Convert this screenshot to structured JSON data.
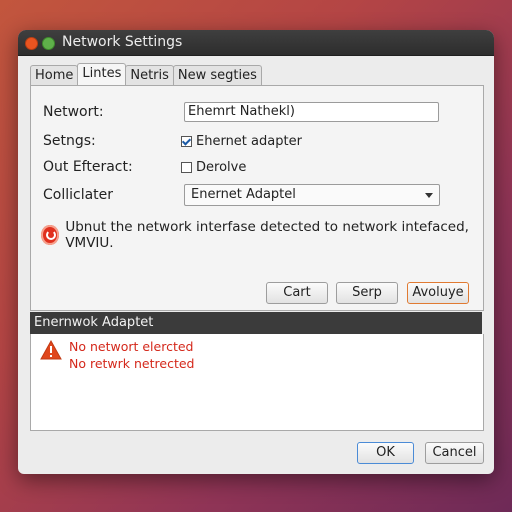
{
  "window": {
    "title": "Network Settings"
  },
  "tabs": [
    {
      "label": "Home",
      "active": false
    },
    {
      "label": "Lintes",
      "active": true
    },
    {
      "label": "Netris",
      "active": false
    },
    {
      "label": "New segties",
      "active": false
    }
  ],
  "form": {
    "network_label": "Networt:",
    "network_value": "Ehemrt Nathekl)",
    "settings_label": "Setngs:",
    "settings_checkbox_label": "Ehernet adapter",
    "settings_checked": true,
    "out_label": "Out Efteract:",
    "out_checkbox_label": "Derolve",
    "out_checked": false,
    "collector_label": "Colliclater",
    "collector_value": "Enernet Adaptel"
  },
  "info_message": "Ubnut the network interfase detected to network intefaced, VMVIU.",
  "buttons": {
    "cart": "Cart",
    "serp": "Serp",
    "avoluye": "Avoluye",
    "ok": "OK",
    "cancel": "Cancel"
  },
  "adapter_section": {
    "header": "Enernwok Adaptet",
    "errors": [
      "No networt elercted",
      "No retwrk netrected"
    ]
  },
  "colors": {
    "titlebar": "#2d2d2d",
    "close_dot": "#e95420",
    "max_dot": "#5fb04a",
    "error_text": "#d4281b",
    "accent_orange": "#e07a32",
    "accent_blue": "#4b8bd6",
    "section_header": "#3b3b3b"
  },
  "icons": {
    "close": "close-dot-icon",
    "maximize": "maximize-dot-icon",
    "info": "error-circle-icon",
    "warning": "warning-triangle-icon",
    "dropdown": "chevron-down-icon"
  }
}
